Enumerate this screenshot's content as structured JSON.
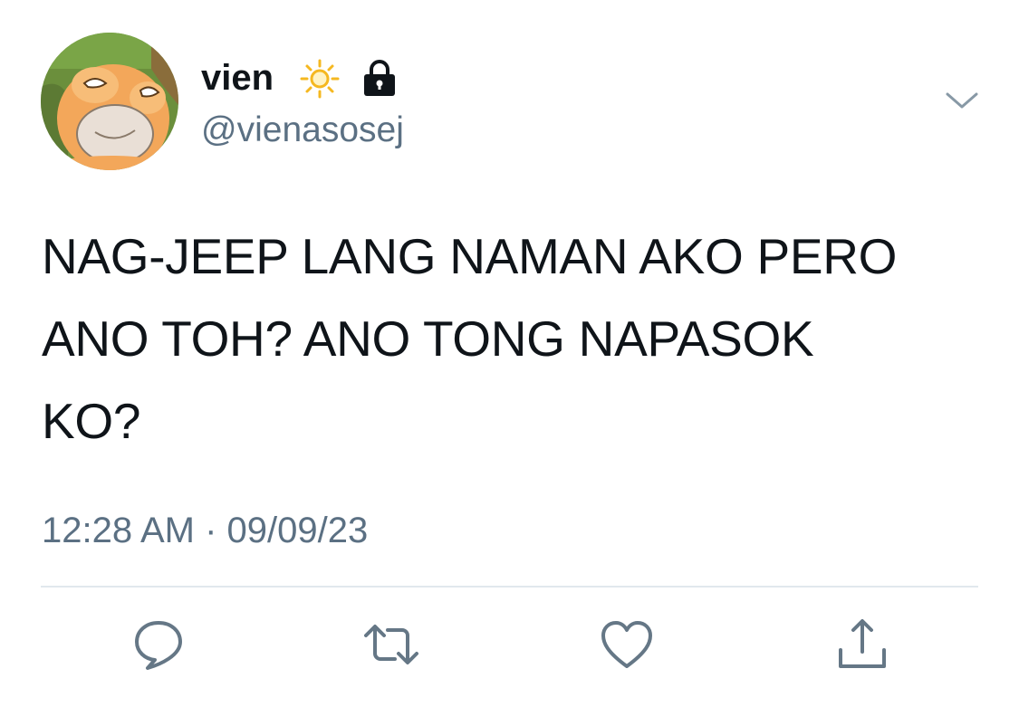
{
  "user": {
    "display_name": "vien",
    "handle": "@vienasosej",
    "badges": [
      "sun-icon",
      "lock-icon"
    ]
  },
  "tweet": {
    "text": "NAG-JEEP LANG NAMAN AKO PERO\nANO TOH? ANO TONG NAPASOK\nKO?",
    "timestamp": "12:28 AM · 09/09/23"
  },
  "actions": [
    "reply-icon",
    "retweet-icon",
    "like-icon",
    "share-icon"
  ],
  "colors": {
    "text": "#0f1419",
    "secondary": "#5b7083",
    "divider": "#e1e8ed",
    "sun": "#f5b820",
    "avatar_body": "#f3a75a"
  }
}
